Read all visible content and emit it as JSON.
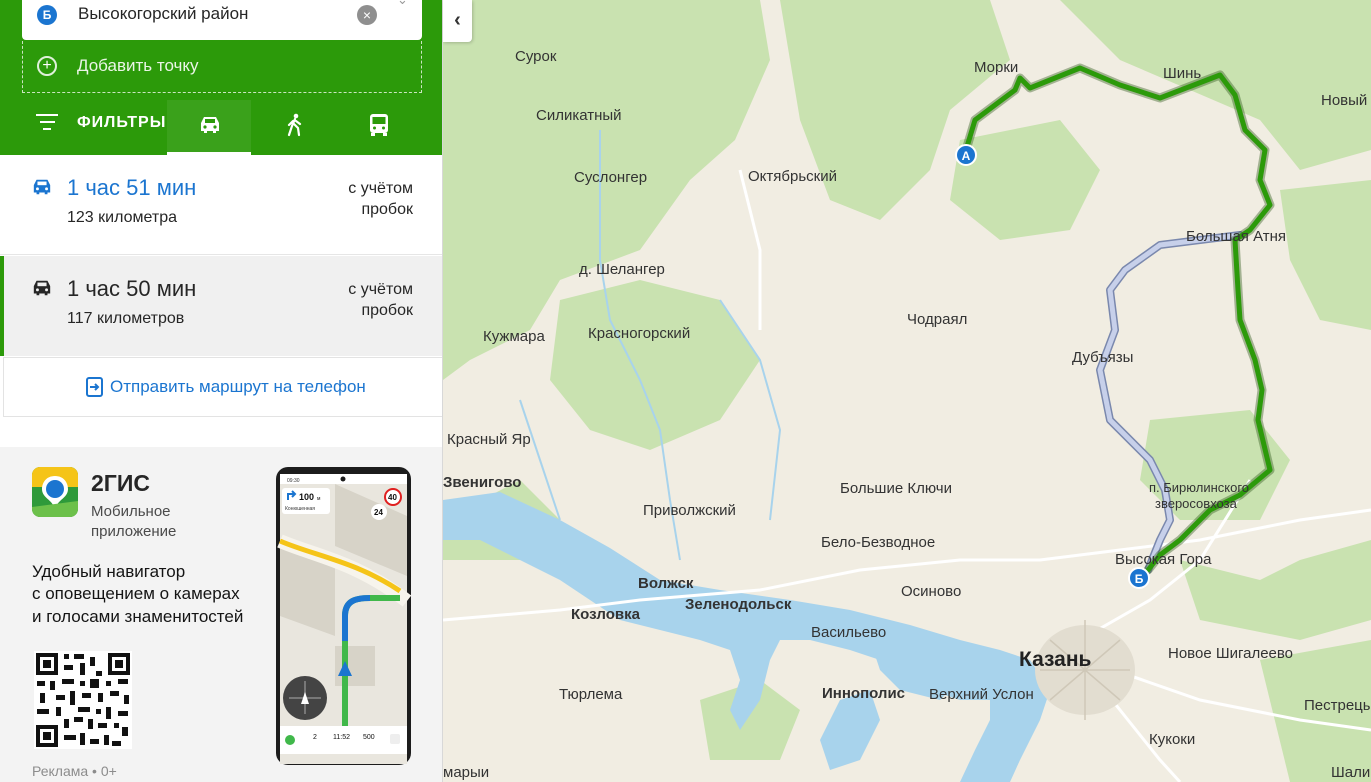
{
  "panel": {
    "point_b": {
      "badge": "Б",
      "value": "Высокогорский район",
      "clear_icon": "clear-icon"
    },
    "add_point": {
      "label": "Добавить точку",
      "icon": "plus-circle-icon"
    },
    "filters": {
      "label": "ФИЛЬТРЫ",
      "modes": [
        {
          "name": "car",
          "icon": "car-icon",
          "active": true
        },
        {
          "name": "walk",
          "icon": "walk-icon",
          "active": false
        },
        {
          "name": "transit",
          "icon": "bus-icon",
          "active": false
        }
      ]
    },
    "routes": [
      {
        "time": "1 час 51 мин",
        "distance": "123 километра",
        "traffic_line1": "с учётом",
        "traffic_line2": "пробок",
        "selected": false
      },
      {
        "time": "1 час 50 мин",
        "distance": "117 километров",
        "traffic_line1": "с учётом",
        "traffic_line2": "пробок",
        "selected": true
      }
    ],
    "send_to_phone": "Отправить маршрут на телефон",
    "ad": {
      "brand": "2ГИС",
      "subtitle_line1": "Мобильное",
      "subtitle_line2": "приложение",
      "headline_line1": "Удобный навигатор",
      "headline_line2": "с оповещением о камерах",
      "headline_line3": "и голосами знаменитостей",
      "label": "Реклама • 0+",
      "phone_screen": {
        "clock": "09:30",
        "distance": "100",
        "distance_unit": "м",
        "street": "Конюшенная",
        "speed_limit": "40",
        "current_speed": "24",
        "stat_1": "2",
        "stat_2": "11:52",
        "stat_3": "500"
      }
    }
  },
  "map": {
    "labels": [
      "Сурок",
      "Морки",
      "Шинь",
      "Новый",
      "Силикатный",
      "Суслонгер",
      "Октябрьский",
      "Большая Атня",
      "д. Шеланлгер",
      "Кужмара",
      "Красногорский",
      "Чодраял",
      "Дубъязы",
      "Красный Яр",
      "Звенигово",
      "Приволжский",
      "Большие Ключи",
      "п. Бирюлинского зверосовхоза",
      "Бело-Безводное",
      "Высокая Гора",
      "Волжск",
      "Зеленодольск",
      "Козловка",
      "Осиново",
      "Васильево",
      "Казань",
      "Новое Шигалеево",
      "Тюрлема",
      "Иннополис",
      "Верхний Услон",
      "Кукоки",
      "Пестрецы",
      "Шали",
      "Марий"
    ],
    "label_Surok": "Сурок",
    "label_Morki": "Морки",
    "label_Shin": "Шинь",
    "label_Noviy": "Новый",
    "label_Silikatny": "Силикатный",
    "label_Suslonger": "Суслонгер",
    "label_Oktyabrsky": "Октябрьский",
    "label_BolshayaAtnya": "Большая Атня",
    "label_Shelanger": "д. Шелангер",
    "label_Kuzhmara": "Кужмара",
    "label_Krasnogorsky": "Красногорский",
    "label_Chodrayal": "Чодраял",
    "label_Dubyazy": "Дубъязы",
    "label_KrasnyYar": "Красный Яр",
    "label_Zvenigovo": "Звенигово",
    "label_Privolzhsky": "Приволжский",
    "label_BolshieKlyuchi": "Большие Ключи",
    "label_Biryulinsky1": "п. Бирюлинского",
    "label_Biryulinsky2": "зверосовхоза",
    "label_BeloBezvodnoe": "Бело-Безводное",
    "label_VysokayaGora": "Высокая Гора",
    "label_Volzhsk": "Волжск",
    "label_Zelenodolsk": "Зеленодольск",
    "label_Kozlovka": "Козловка",
    "label_Osinovo": "Осиново",
    "label_Vasilevo": "Васильево",
    "label_Kazan": "Казань",
    "label_NovoeShigaleevo": "Новое Шигалеево",
    "label_Tyurlema": "Тюрлема",
    "label_Innopolis": "Иннополис",
    "label_VerkhniyUslon": "Верхний Услон",
    "label_Kukoki": "Кукоки",
    "label_Pestretsy": "Пестрецы",
    "label_Shali": "Шали",
    "label_Mariy": "марыи",
    "marker_a": "А",
    "marker_b": "Б",
    "collapse_icon": "chevron-left-icon",
    "colors": {
      "route_active": "#2c9a0a",
      "route_alt": "#a9b6d6",
      "water": "#a8d3ec",
      "forest": "#c9e2b0"
    }
  }
}
